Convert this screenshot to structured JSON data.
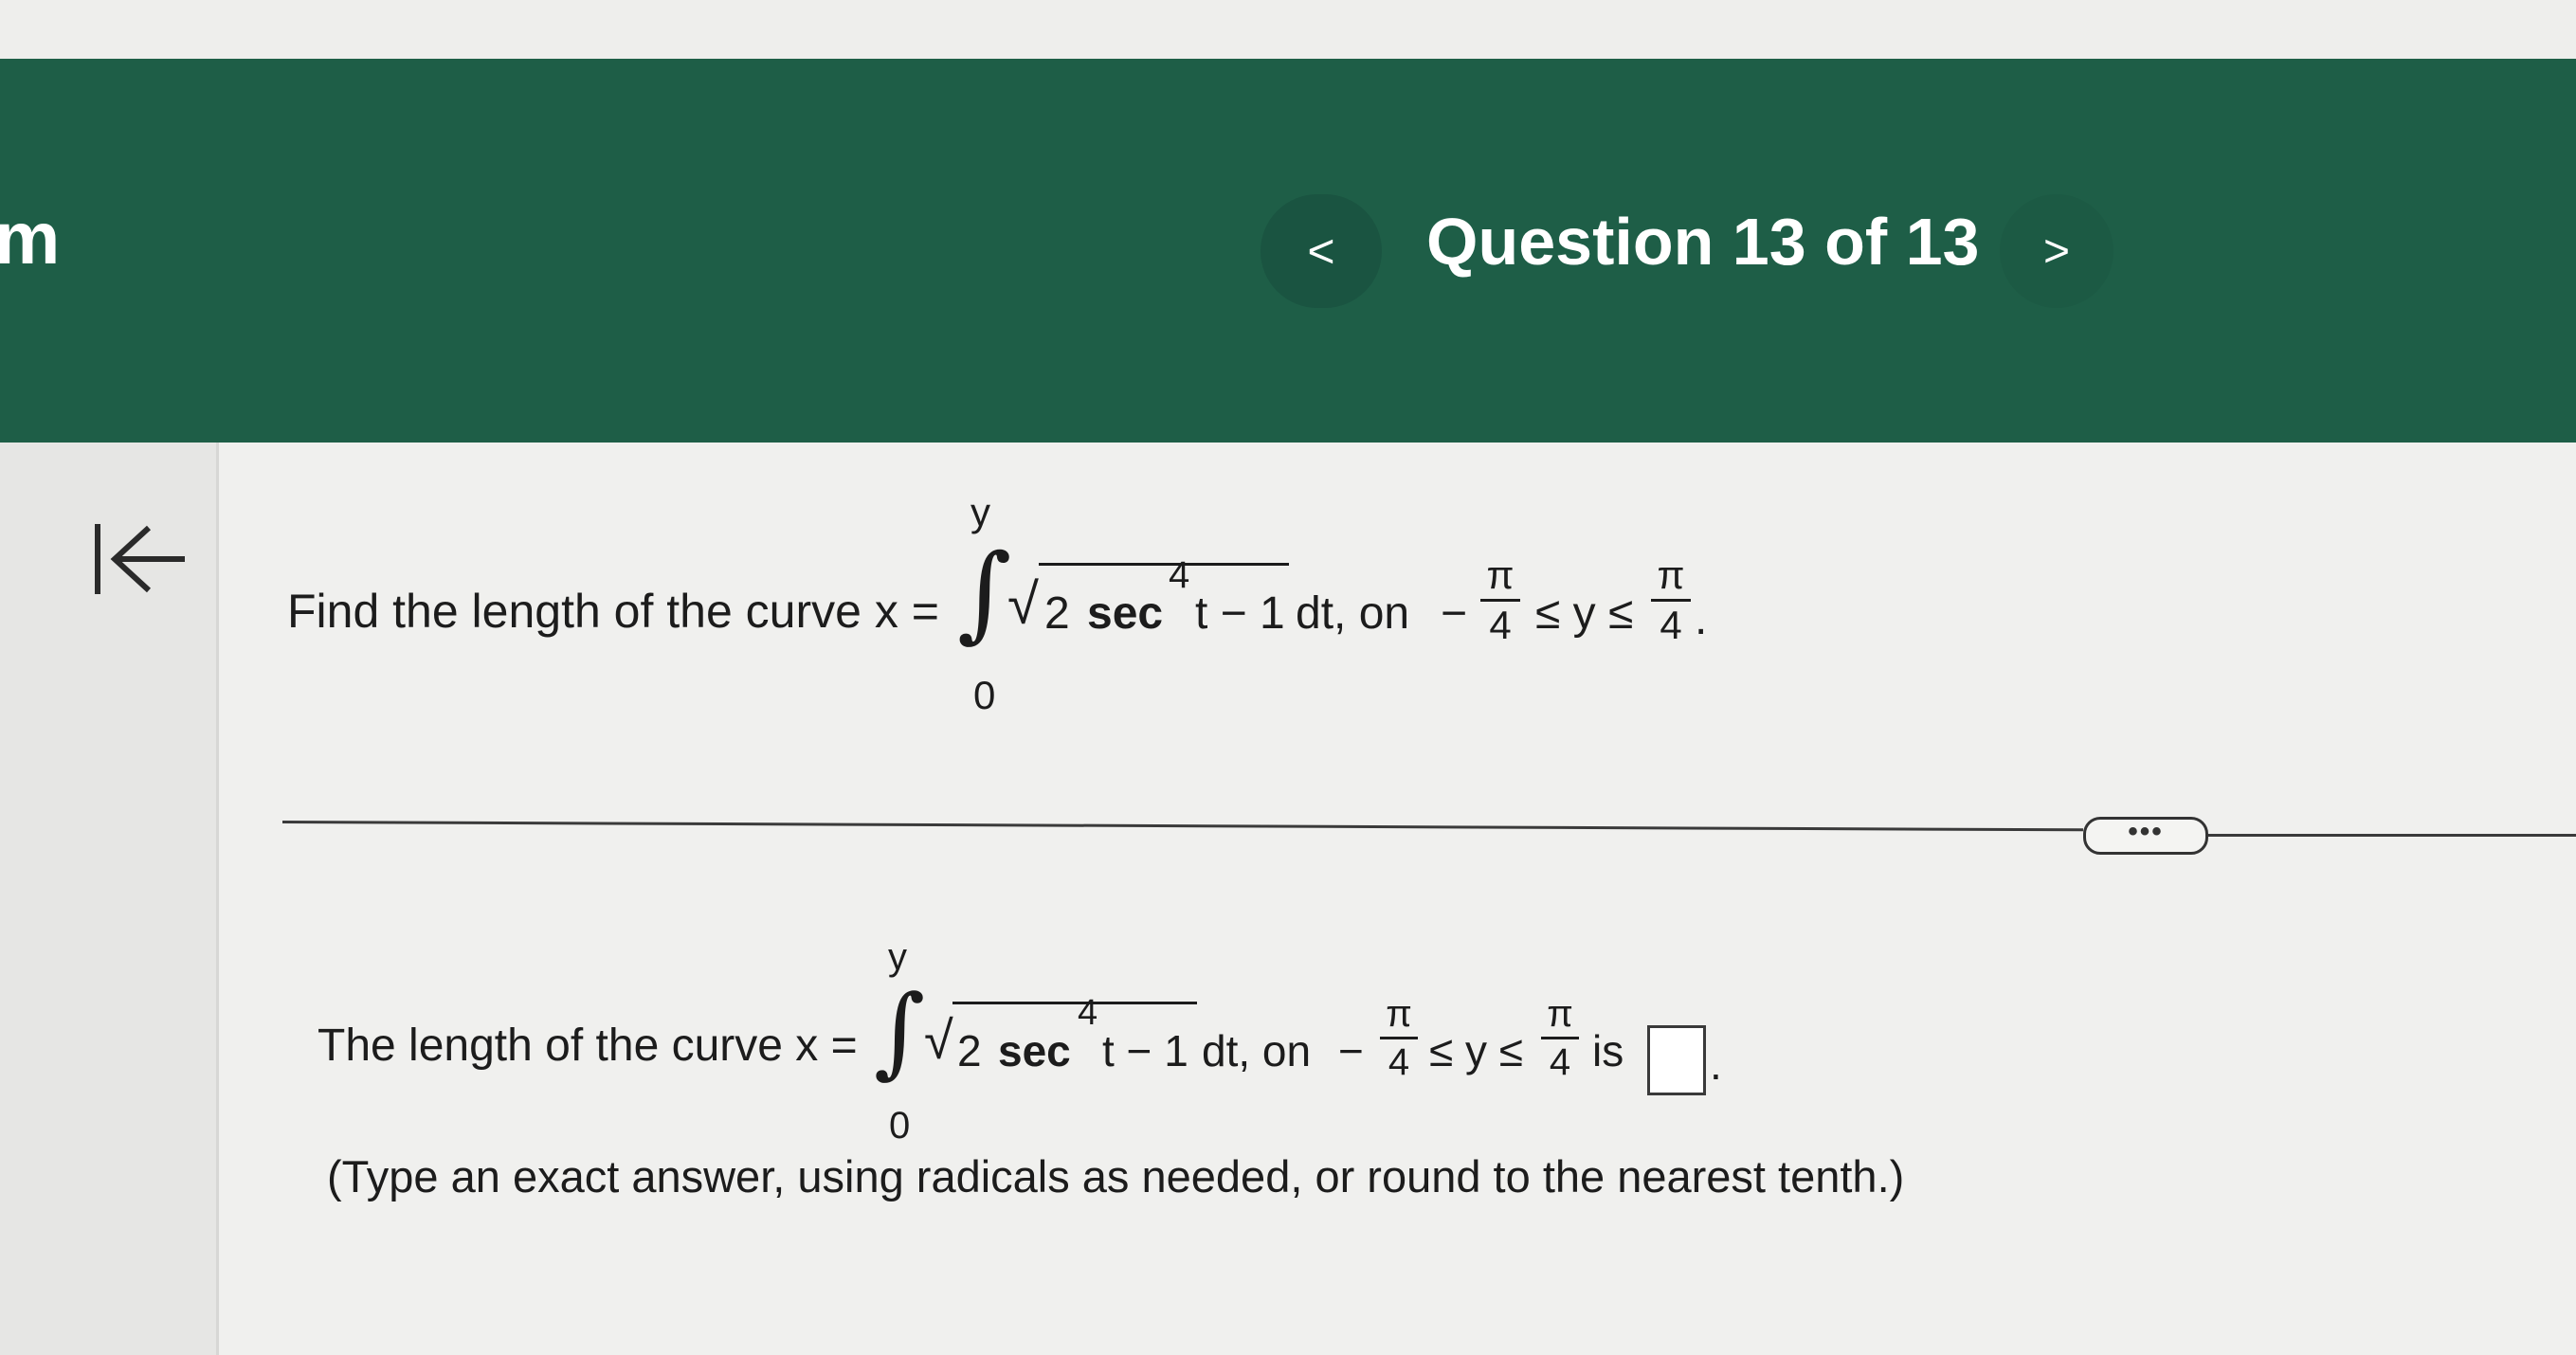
{
  "header": {
    "brand": "m",
    "question_title": "Question 13 of 13",
    "prev_label": "<",
    "next_label": ">"
  },
  "sidebar": {
    "collapse_icon": "collapse-left-icon"
  },
  "question": {
    "prefix": "Find the length of the curve x =",
    "integral_upper": "y",
    "integral_lower": "0",
    "integrand_coef": "2",
    "integrand_func": "sec",
    "integrand_exp": "4",
    "integrand_rest": "t − 1",
    "dt_on": "dt, on",
    "lower_sign": "−",
    "frac_num": "π",
    "frac_den": "4",
    "ineq": "≤ y ≤",
    "end": "."
  },
  "more_button": {
    "label": "•••"
  },
  "answer": {
    "prefix": "The length of the curve x =",
    "integral_upper": "y",
    "integral_lower": "0",
    "integrand_coef": "2",
    "integrand_func": "sec",
    "integrand_exp": "4",
    "integrand_rest": "t − 1",
    "dt_on": "dt, on",
    "lower_sign": "−",
    "frac_num": "π",
    "frac_den": "4",
    "ineq": "≤ y ≤",
    "is_label": "is",
    "end": ".",
    "instruction": "(Type an exact answer, using radicals as needed, or round to the nearest tenth.)"
  },
  "colors": {
    "header_green": "#1e5e47",
    "page_bg": "#f0f0ee"
  }
}
